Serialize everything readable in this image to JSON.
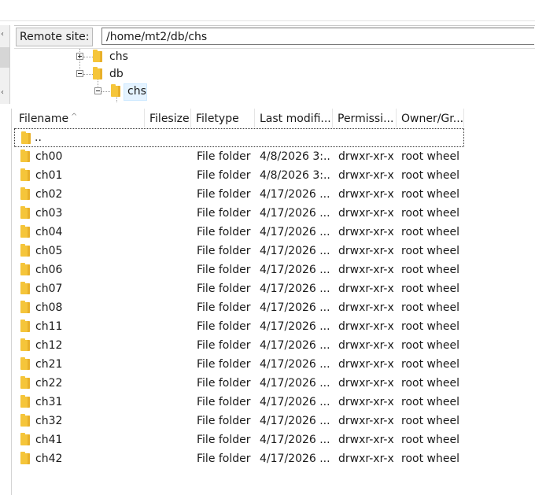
{
  "remote": {
    "label": "Remote site:",
    "path": "/home/mt2/db/chs"
  },
  "tree": [
    {
      "name": "chs",
      "expander": "plus",
      "selected": false
    },
    {
      "name": "db",
      "expander": "minus",
      "selected": false
    },
    {
      "name": "chs",
      "expander": "minus",
      "selected": true
    }
  ],
  "columns": [
    "Filename",
    "Filesize",
    "Filetype",
    "Last modifi...",
    "Permissi...",
    "Owner/Gr..."
  ],
  "parent_entry": "..",
  "files": [
    {
      "name": "ch00",
      "size": "",
      "type": "File folder",
      "modified": "4/8/2026 3:...",
      "perms": "drwxr-xr-x",
      "owner": "root wheel"
    },
    {
      "name": "ch01",
      "size": "",
      "type": "File folder",
      "modified": "4/8/2026 3:...",
      "perms": "drwxr-xr-x",
      "owner": "root wheel"
    },
    {
      "name": "ch02",
      "size": "",
      "type": "File folder",
      "modified": "4/17/2026 ...",
      "perms": "drwxr-xr-x",
      "owner": "root wheel"
    },
    {
      "name": "ch03",
      "size": "",
      "type": "File folder",
      "modified": "4/17/2026 ...",
      "perms": "drwxr-xr-x",
      "owner": "root wheel"
    },
    {
      "name": "ch04",
      "size": "",
      "type": "File folder",
      "modified": "4/17/2026 ...",
      "perms": "drwxr-xr-x",
      "owner": "root wheel"
    },
    {
      "name": "ch05",
      "size": "",
      "type": "File folder",
      "modified": "4/17/2026 ...",
      "perms": "drwxr-xr-x",
      "owner": "root wheel"
    },
    {
      "name": "ch06",
      "size": "",
      "type": "File folder",
      "modified": "4/17/2026 ...",
      "perms": "drwxr-xr-x",
      "owner": "root wheel"
    },
    {
      "name": "ch07",
      "size": "",
      "type": "File folder",
      "modified": "4/17/2026 ...",
      "perms": "drwxr-xr-x",
      "owner": "root wheel"
    },
    {
      "name": "ch08",
      "size": "",
      "type": "File folder",
      "modified": "4/17/2026 ...",
      "perms": "drwxr-xr-x",
      "owner": "root wheel"
    },
    {
      "name": "ch11",
      "size": "",
      "type": "File folder",
      "modified": "4/17/2026 ...",
      "perms": "drwxr-xr-x",
      "owner": "root wheel"
    },
    {
      "name": "ch12",
      "size": "",
      "type": "File folder",
      "modified": "4/17/2026 ...",
      "perms": "drwxr-xr-x",
      "owner": "root wheel"
    },
    {
      "name": "ch21",
      "size": "",
      "type": "File folder",
      "modified": "4/17/2026 ...",
      "perms": "drwxr-xr-x",
      "owner": "root wheel"
    },
    {
      "name": "ch22",
      "size": "",
      "type": "File folder",
      "modified": "4/17/2026 ...",
      "perms": "drwxr-xr-x",
      "owner": "root wheel"
    },
    {
      "name": "ch31",
      "size": "",
      "type": "File folder",
      "modified": "4/17/2026 ...",
      "perms": "drwxr-xr-x",
      "owner": "root wheel"
    },
    {
      "name": "ch32",
      "size": "",
      "type": "File folder",
      "modified": "4/17/2026 ...",
      "perms": "drwxr-xr-x",
      "owner": "root wheel"
    },
    {
      "name": "ch41",
      "size": "",
      "type": "File folder",
      "modified": "4/17/2026 ...",
      "perms": "drwxr-xr-x",
      "owner": "root wheel"
    },
    {
      "name": "ch42",
      "size": "",
      "type": "File folder",
      "modified": "4/17/2026 ...",
      "perms": "drwxr-xr-x",
      "owner": "root wheel"
    }
  ],
  "colors": {
    "folder": "#f5c53a",
    "selection": "#e5f3ff"
  },
  "icons": {
    "folder": "folder-icon",
    "expander_plus": "tree-expand-icon",
    "expander_minus": "tree-collapse-icon",
    "sort": "sort-ascending-icon"
  }
}
